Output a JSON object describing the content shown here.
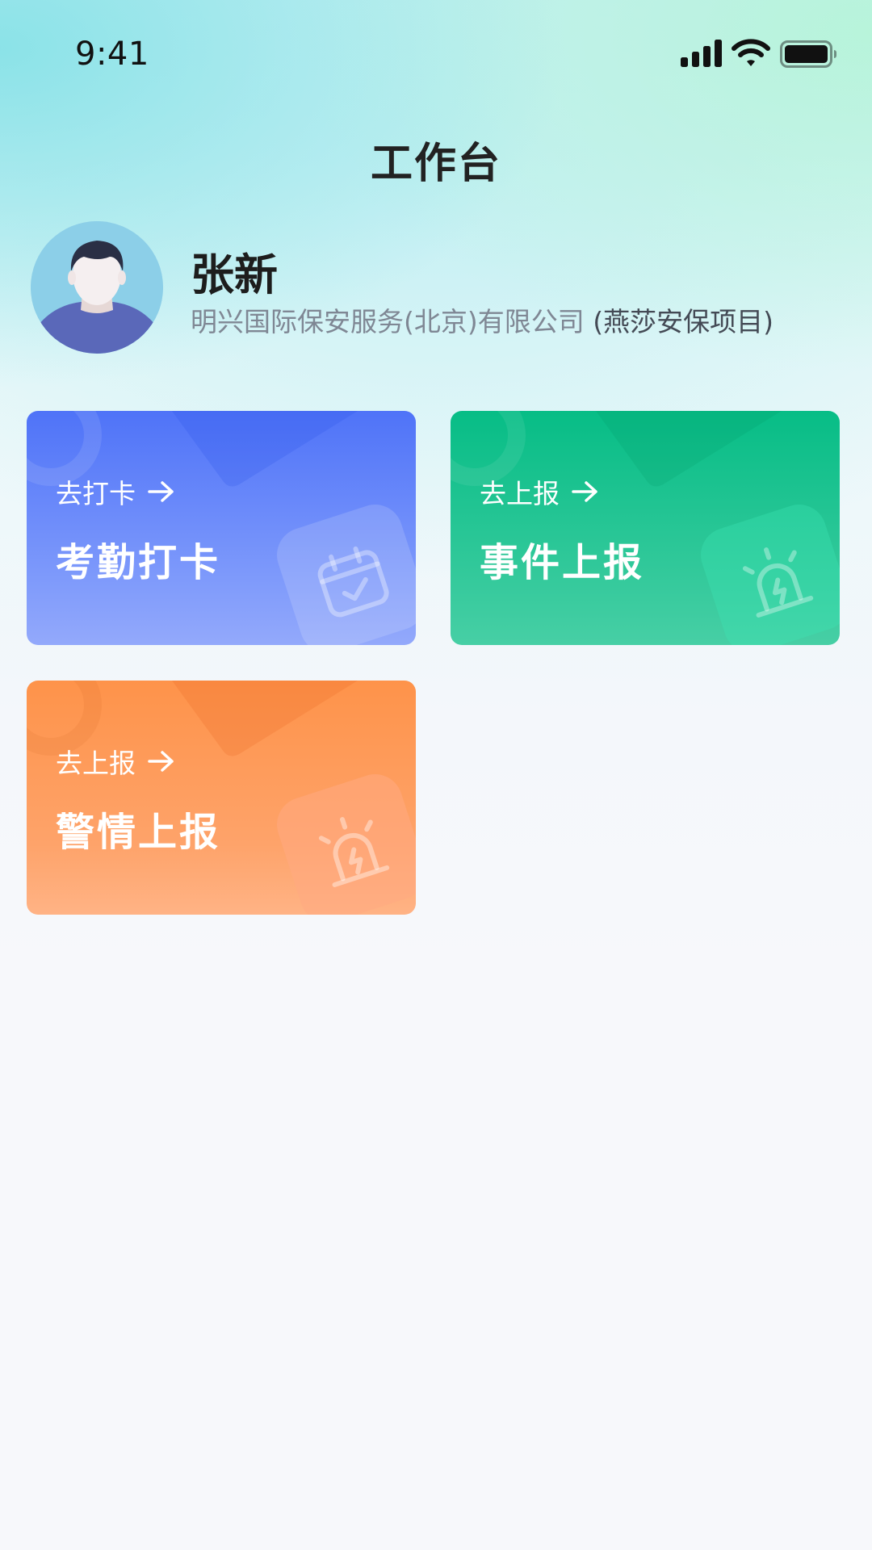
{
  "status_bar": {
    "time": "9:41"
  },
  "header": {
    "title": "工作台"
  },
  "profile": {
    "name": "张新",
    "company": "明兴国际保安服务(北京)有限公司",
    "project": "(燕莎安保项目)"
  },
  "cards": [
    {
      "action": "去打卡",
      "title": "考勤打卡",
      "icon": "calendar-check-icon",
      "color": "#4f73f8"
    },
    {
      "action": "去上报",
      "title": "事件上报",
      "icon": "alarm-siren-icon",
      "color": "#07bd86"
    },
    {
      "action": "去上报",
      "title": "警情上报",
      "icon": "alarm-siren-icon",
      "color": "#fe934a"
    }
  ]
}
